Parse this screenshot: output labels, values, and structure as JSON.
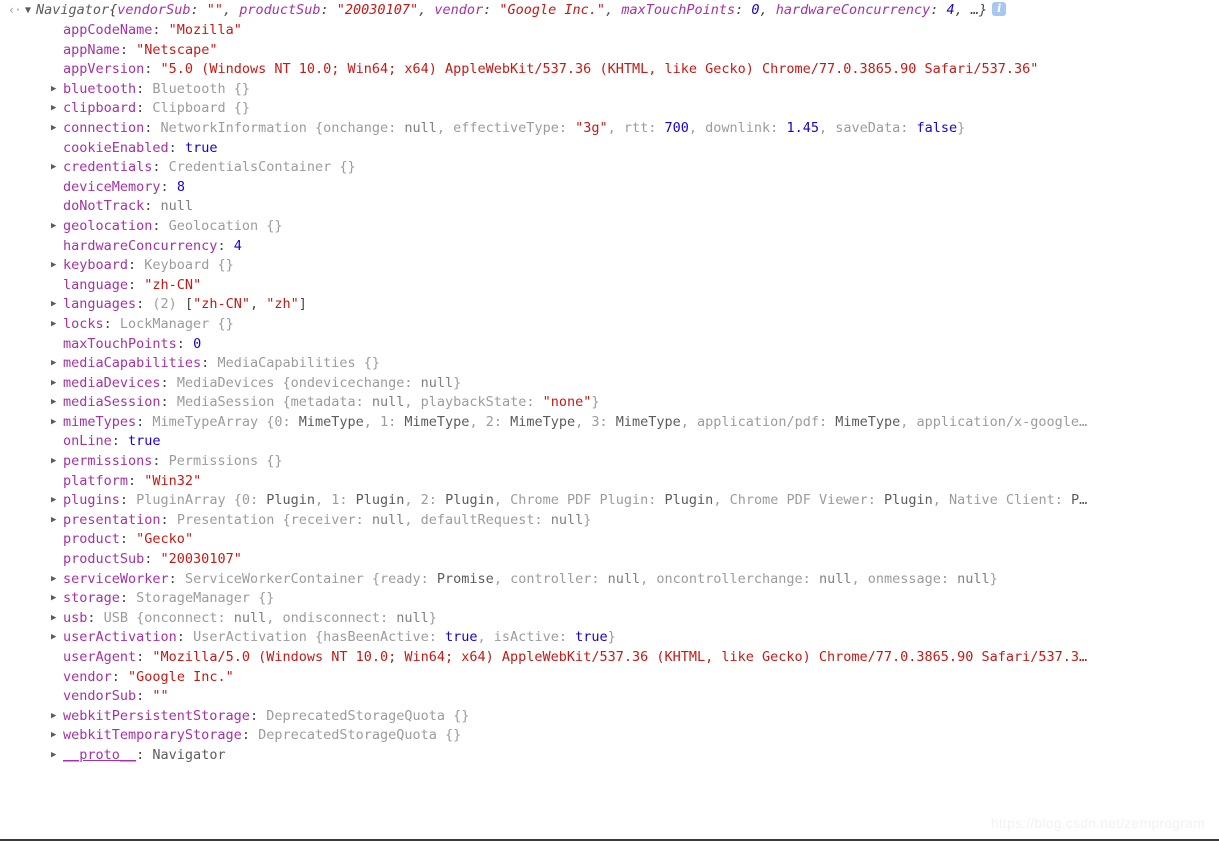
{
  "console": {
    "result_arrow_glyph": "‹·",
    "root": {
      "toggle_glyph": "▼",
      "class_name": "Navigator",
      "preview_open": "{",
      "preview_close": ", …}",
      "preview_items": [
        {
          "key": "vendorSub",
          "sep": ": ",
          "value": "\"\"",
          "value_type": "string",
          "tail": ", "
        },
        {
          "key": "productSub",
          "sep": ": ",
          "value": "\"20030107\"",
          "value_type": "string",
          "tail": ", "
        },
        {
          "key": "vendor",
          "sep": ": ",
          "value": "\"Google Inc.\"",
          "value_type": "string",
          "tail": ", "
        },
        {
          "key": "maxTouchPoints",
          "sep": ": ",
          "value": "0",
          "value_type": "number",
          "tail": ", "
        },
        {
          "key": "hardwareConcurrency",
          "sep": ": ",
          "value": "4",
          "value_type": "number",
          "tail": ""
        }
      ],
      "info_badge": {
        "name": "info-icon",
        "glyph": "i",
        "color": "#a8c7f0"
      }
    },
    "triangle_glyph": "▶",
    "properties": [
      {
        "expandable": false,
        "name": "appCodeName",
        "sep": ": ",
        "parts": [
          {
            "t": "\"Mozilla\"",
            "c": "k-string"
          }
        ]
      },
      {
        "expandable": false,
        "name": "appName",
        "sep": ": ",
        "parts": [
          {
            "t": "\"Netscape\"",
            "c": "k-string"
          }
        ]
      },
      {
        "expandable": false,
        "name": "appVersion",
        "sep": ": ",
        "parts": [
          {
            "t": "\"5.0 (Windows NT 10.0; Win64; x64) AppleWebKit/537.36 (KHTML, like Gecko) Chrome/77.0.3865.90 Safari/537.36\"",
            "c": "k-string"
          }
        ]
      },
      {
        "expandable": true,
        "name": "bluetooth",
        "sep": ": ",
        "parts": [
          {
            "t": "Bluetooth {}",
            "c": "k-obj"
          }
        ]
      },
      {
        "expandable": true,
        "name": "clipboard",
        "sep": ": ",
        "parts": [
          {
            "t": "Clipboard {}",
            "c": "k-obj"
          }
        ]
      },
      {
        "expandable": true,
        "name": "connection",
        "sep": ": ",
        "parts": [
          {
            "t": "NetworkInformation {onchange: ",
            "c": "k-obj"
          },
          {
            "t": "null",
            "c": "k-null"
          },
          {
            "t": ", effectiveType: ",
            "c": "k-obj"
          },
          {
            "t": "\"3g\"",
            "c": "k-string"
          },
          {
            "t": ", rtt: ",
            "c": "k-obj"
          },
          {
            "t": "700",
            "c": "k-number"
          },
          {
            "t": ", downlink: ",
            "c": "k-obj"
          },
          {
            "t": "1.45",
            "c": "k-number"
          },
          {
            "t": ", saveData: ",
            "c": "k-obj"
          },
          {
            "t": "false",
            "c": "k-keyword"
          },
          {
            "t": "}",
            "c": "k-obj"
          }
        ]
      },
      {
        "expandable": false,
        "name": "cookieEnabled",
        "sep": ": ",
        "parts": [
          {
            "t": "true",
            "c": "k-keyword"
          }
        ]
      },
      {
        "expandable": true,
        "name": "credentials",
        "sep": ": ",
        "parts": [
          {
            "t": "CredentialsContainer {}",
            "c": "k-obj"
          }
        ]
      },
      {
        "expandable": false,
        "name": "deviceMemory",
        "sep": ": ",
        "parts": [
          {
            "t": "8",
            "c": "k-number"
          }
        ]
      },
      {
        "expandable": false,
        "name": "doNotTrack",
        "sep": ": ",
        "parts": [
          {
            "t": "null",
            "c": "k-null"
          }
        ]
      },
      {
        "expandable": true,
        "name": "geolocation",
        "sep": ": ",
        "parts": [
          {
            "t": "Geolocation {}",
            "c": "k-obj"
          }
        ]
      },
      {
        "expandable": false,
        "name": "hardwareConcurrency",
        "sep": ": ",
        "parts": [
          {
            "t": "4",
            "c": "k-number"
          }
        ]
      },
      {
        "expandable": true,
        "name": "keyboard",
        "sep": ": ",
        "parts": [
          {
            "t": "Keyboard {}",
            "c": "k-obj"
          }
        ]
      },
      {
        "expandable": false,
        "name": "language",
        "sep": ": ",
        "parts": [
          {
            "t": "\"zh-CN\"",
            "c": "k-string"
          }
        ]
      },
      {
        "expandable": true,
        "name": "languages",
        "sep": ": ",
        "parts": [
          {
            "t": "(2) ",
            "c": "k-obj"
          },
          {
            "t": "[",
            "c": "k-punct"
          },
          {
            "t": "\"zh-CN\"",
            "c": "k-string"
          },
          {
            "t": ", ",
            "c": "k-punct"
          },
          {
            "t": "\"zh\"",
            "c": "k-string"
          },
          {
            "t": "]",
            "c": "k-punct"
          }
        ]
      },
      {
        "expandable": true,
        "name": "locks",
        "sep": ": ",
        "parts": [
          {
            "t": "LockManager {}",
            "c": "k-obj"
          }
        ]
      },
      {
        "expandable": false,
        "name": "maxTouchPoints",
        "sep": ": ",
        "parts": [
          {
            "t": "0",
            "c": "k-number"
          }
        ]
      },
      {
        "expandable": true,
        "name": "mediaCapabilities",
        "sep": ": ",
        "parts": [
          {
            "t": "MediaCapabilities {}",
            "c": "k-obj"
          }
        ]
      },
      {
        "expandable": true,
        "name": "mediaDevices",
        "sep": ": ",
        "parts": [
          {
            "t": "MediaDevices {ondevicechange: ",
            "c": "k-obj"
          },
          {
            "t": "null",
            "c": "k-null"
          },
          {
            "t": "}",
            "c": "k-obj"
          }
        ]
      },
      {
        "expandable": true,
        "name": "mediaSession",
        "sep": ": ",
        "parts": [
          {
            "t": "MediaSession {metadata: ",
            "c": "k-obj"
          },
          {
            "t": "null",
            "c": "k-null"
          },
          {
            "t": ", playbackState: ",
            "c": "k-obj"
          },
          {
            "t": "\"none\"",
            "c": "k-string"
          },
          {
            "t": "}",
            "c": "k-obj"
          }
        ]
      },
      {
        "expandable": true,
        "name": "mimeTypes",
        "sep": ": ",
        "parts": [
          {
            "t": "MimeTypeArray {0: ",
            "c": "k-obj"
          },
          {
            "t": "MimeType",
            "c": "k-objdark"
          },
          {
            "t": ", 1: ",
            "c": "k-obj"
          },
          {
            "t": "MimeType",
            "c": "k-objdark"
          },
          {
            "t": ", 2: ",
            "c": "k-obj"
          },
          {
            "t": "MimeType",
            "c": "k-objdark"
          },
          {
            "t": ", 3: ",
            "c": "k-obj"
          },
          {
            "t": "MimeType",
            "c": "k-objdark"
          },
          {
            "t": ", application/pdf: ",
            "c": "k-obj"
          },
          {
            "t": "MimeType",
            "c": "k-objdark"
          },
          {
            "t": ", application/x-google…",
            "c": "k-obj"
          }
        ]
      },
      {
        "expandable": false,
        "name": "onLine",
        "sep": ": ",
        "parts": [
          {
            "t": "true",
            "c": "k-keyword"
          }
        ]
      },
      {
        "expandable": true,
        "name": "permissions",
        "sep": ": ",
        "parts": [
          {
            "t": "Permissions {}",
            "c": "k-obj"
          }
        ]
      },
      {
        "expandable": false,
        "name": "platform",
        "sep": ": ",
        "parts": [
          {
            "t": "\"Win32\"",
            "c": "k-string"
          }
        ]
      },
      {
        "expandable": true,
        "name": "plugins",
        "sep": ": ",
        "parts": [
          {
            "t": "PluginArray {0: ",
            "c": "k-obj"
          },
          {
            "t": "Plugin",
            "c": "k-objdark"
          },
          {
            "t": ", 1: ",
            "c": "k-obj"
          },
          {
            "t": "Plugin",
            "c": "k-objdark"
          },
          {
            "t": ", 2: ",
            "c": "k-obj"
          },
          {
            "t": "Plugin",
            "c": "k-objdark"
          },
          {
            "t": ", Chrome PDF Plugin: ",
            "c": "k-obj"
          },
          {
            "t": "Plugin",
            "c": "k-objdark"
          },
          {
            "t": ", Chrome PDF Viewer: ",
            "c": "k-obj"
          },
          {
            "t": "Plugin",
            "c": "k-objdark"
          },
          {
            "t": ", Native Client: ",
            "c": "k-obj"
          },
          {
            "t": "P…",
            "c": "k-objdark"
          }
        ]
      },
      {
        "expandable": true,
        "name": "presentation",
        "sep": ": ",
        "parts": [
          {
            "t": "Presentation {receiver: ",
            "c": "k-obj"
          },
          {
            "t": "null",
            "c": "k-null"
          },
          {
            "t": ", defaultRequest: ",
            "c": "k-obj"
          },
          {
            "t": "null",
            "c": "k-null"
          },
          {
            "t": "}",
            "c": "k-obj"
          }
        ]
      },
      {
        "expandable": false,
        "name": "product",
        "sep": ": ",
        "parts": [
          {
            "t": "\"Gecko\"",
            "c": "k-string"
          }
        ]
      },
      {
        "expandable": false,
        "name": "productSub",
        "sep": ": ",
        "parts": [
          {
            "t": "\"20030107\"",
            "c": "k-string"
          }
        ]
      },
      {
        "expandable": true,
        "name": "serviceWorker",
        "sep": ": ",
        "parts": [
          {
            "t": "ServiceWorkerContainer {ready: ",
            "c": "k-obj"
          },
          {
            "t": "Promise",
            "c": "k-objdark"
          },
          {
            "t": ", controller: ",
            "c": "k-obj"
          },
          {
            "t": "null",
            "c": "k-null"
          },
          {
            "t": ", oncontrollerchange: ",
            "c": "k-obj"
          },
          {
            "t": "null",
            "c": "k-null"
          },
          {
            "t": ", onmessage: ",
            "c": "k-obj"
          },
          {
            "t": "null",
            "c": "k-null"
          },
          {
            "t": "}",
            "c": "k-obj"
          }
        ]
      },
      {
        "expandable": true,
        "name": "storage",
        "sep": ": ",
        "parts": [
          {
            "t": "StorageManager {}",
            "c": "k-obj"
          }
        ]
      },
      {
        "expandable": true,
        "name": "usb",
        "sep": ": ",
        "parts": [
          {
            "t": "USB {onconnect: ",
            "c": "k-obj"
          },
          {
            "t": "null",
            "c": "k-null"
          },
          {
            "t": ", ondisconnect: ",
            "c": "k-obj"
          },
          {
            "t": "null",
            "c": "k-null"
          },
          {
            "t": "}",
            "c": "k-obj"
          }
        ]
      },
      {
        "expandable": true,
        "name": "userActivation",
        "sep": ": ",
        "parts": [
          {
            "t": "UserActivation {hasBeenActive: ",
            "c": "k-obj"
          },
          {
            "t": "true",
            "c": "k-keyword"
          },
          {
            "t": ", isActive: ",
            "c": "k-obj"
          },
          {
            "t": "true",
            "c": "k-keyword"
          },
          {
            "t": "}",
            "c": "k-obj"
          }
        ]
      },
      {
        "expandable": false,
        "name": "userAgent",
        "sep": ": ",
        "parts": [
          {
            "t": "\"Mozilla/5.0 (Windows NT 10.0; Win64; x64) AppleWebKit/537.36 (KHTML, like Gecko) Chrome/77.0.3865.90 Safari/537.3…",
            "c": "k-string"
          }
        ]
      },
      {
        "expandable": false,
        "name": "vendor",
        "sep": ": ",
        "parts": [
          {
            "t": "\"Google Inc.\"",
            "c": "k-string"
          }
        ]
      },
      {
        "expandable": false,
        "name": "vendorSub",
        "sep": ": ",
        "parts": [
          {
            "t": "\"\"",
            "c": "k-string"
          }
        ]
      },
      {
        "expandable": true,
        "name": "webkitPersistentStorage",
        "sep": ": ",
        "parts": [
          {
            "t": "DeprecatedStorageQuota {}",
            "c": "k-obj"
          }
        ]
      },
      {
        "expandable": true,
        "name": "webkitTemporaryStorage",
        "sep": ": ",
        "parts": [
          {
            "t": "DeprecatedStorageQuota {}",
            "c": "k-obj"
          }
        ]
      },
      {
        "expandable": true,
        "name": "__proto__",
        "sep": ": ",
        "is_proto": true,
        "parts": [
          {
            "t": "Navigator",
            "c": "k-objdark"
          }
        ]
      }
    ]
  },
  "watermark": {
    "text": "https://blog.csdn.net/zemprogram"
  },
  "colors": {
    "property_name": "#a532a5",
    "string": "#c41a16",
    "number": "#1c00cf",
    "keyword": "#1c00cf",
    "null": "#808080",
    "object_preview": "#9c9c9c",
    "info_badge": "#a8c7f0",
    "background": "#ffffff"
  }
}
